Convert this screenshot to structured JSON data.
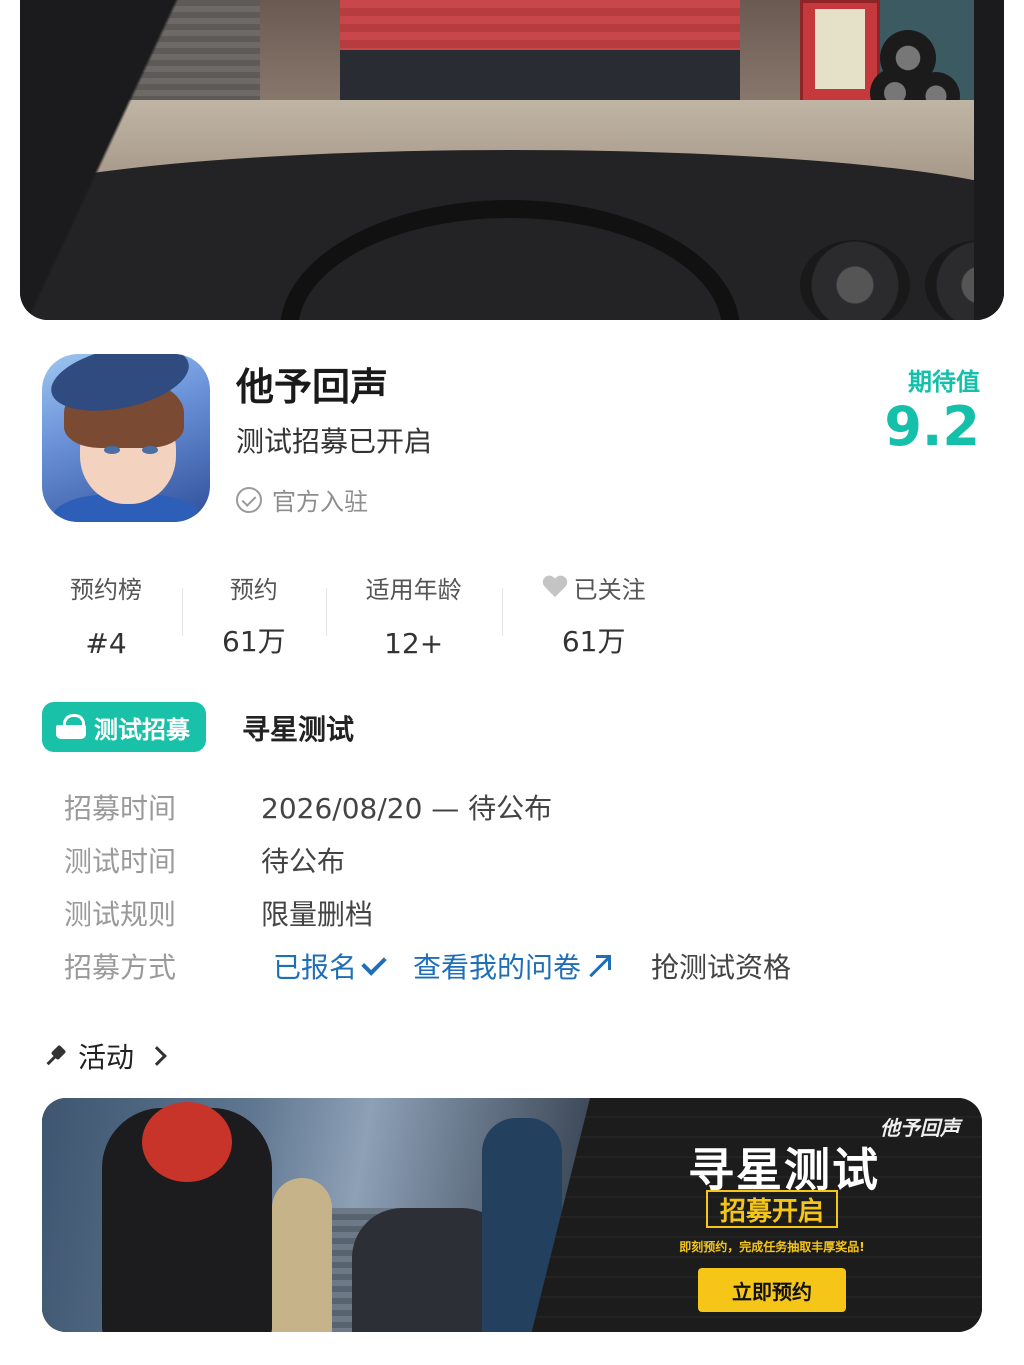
{
  "game": {
    "title": "他予回声",
    "subtitle": "测试招募已开启",
    "verified_label": "官方入驻",
    "expect_label": "期待值",
    "expect_value": "9.2"
  },
  "stats": [
    {
      "label": "预约榜",
      "value": "#4"
    },
    {
      "label": "预约",
      "value": "61万"
    },
    {
      "label": "适用年龄",
      "value": "12+"
    },
    {
      "label": "已关注",
      "value": "61万"
    }
  ],
  "recruitment": {
    "badge_label": "测试招募",
    "title": "寻星测试",
    "rows": [
      {
        "key": "招募时间",
        "value": "2026/08/20 — 待公布"
      },
      {
        "key": "测试时间",
        "value": "待公布"
      },
      {
        "key": "测试规则",
        "value": "限量删档"
      },
      {
        "key": "招募方式"
      }
    ],
    "registered_label": "已报名",
    "questionnaire_label": "查看我的问卷",
    "grab_label": "抢测试资格"
  },
  "activity": {
    "header_label": "活动",
    "banner": {
      "logo": "他予回声",
      "title": "寻星测试",
      "subtitle": "招募开启",
      "desc": "即刻预约，完成任务抽取丰厚奖品!",
      "button_label": "立即预约"
    }
  },
  "colors": {
    "accent": "#18c1a8",
    "link": "#1f6fb8",
    "banner_yellow": "#f5c518"
  }
}
